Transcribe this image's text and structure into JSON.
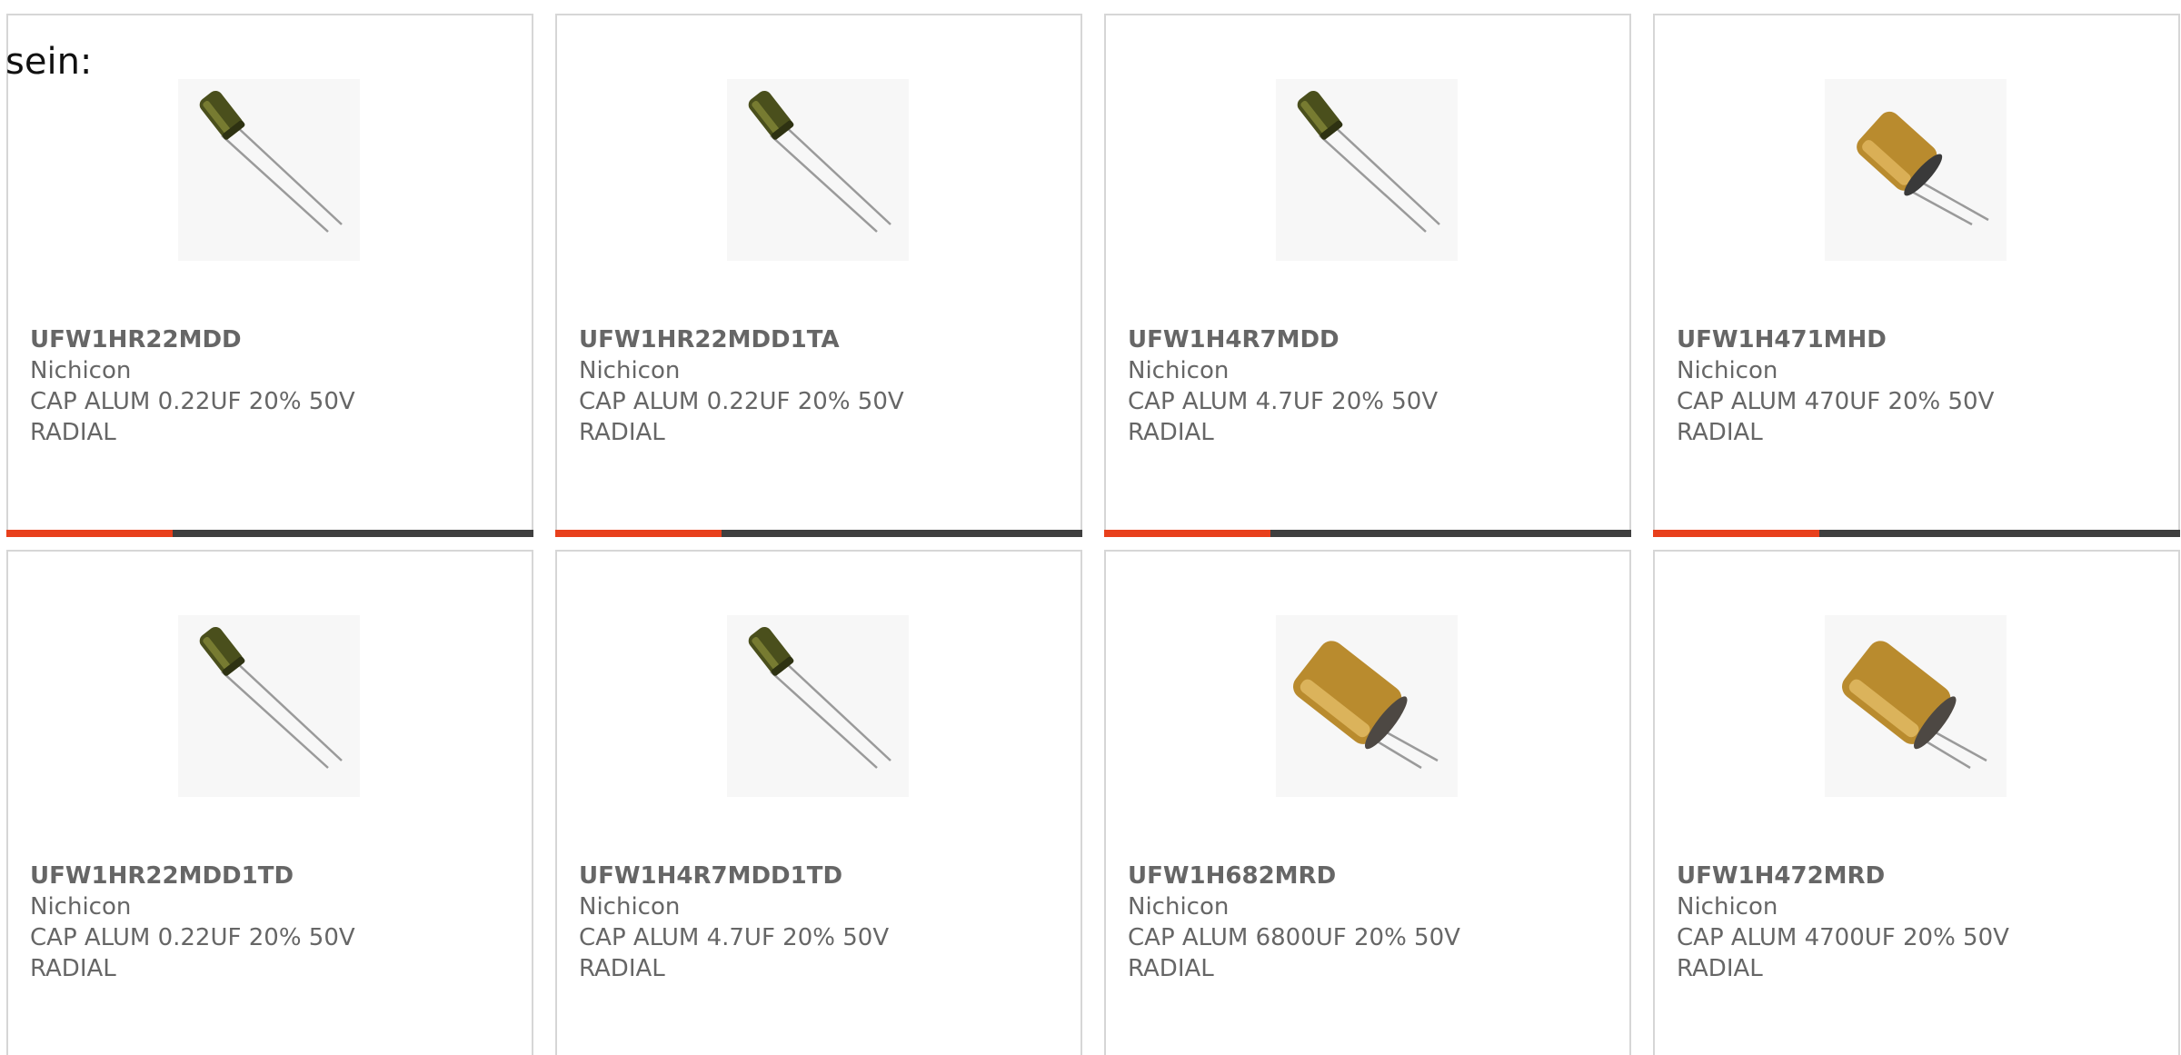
{
  "intro_text": "sein:",
  "colors": {
    "accent": "#e8401c",
    "bar": "#3f3f3f",
    "border": "#d6d6d6",
    "text": "#666666"
  },
  "products": [
    {
      "part": "UFW1HR22MDD",
      "manufacturer": "Nichicon",
      "description": "CAP ALUM 0.22UF 20% 50V RADIAL",
      "image": "small-green-capacitor"
    },
    {
      "part": "UFW1HR22MDD1TA",
      "manufacturer": "Nichicon",
      "description": "CAP ALUM 0.22UF 20% 50V RADIAL",
      "image": "small-green-capacitor"
    },
    {
      "part": "UFW1H4R7MDD",
      "manufacturer": "Nichicon",
      "description": "CAP ALUM 4.7UF 20% 50V RADIAL",
      "image": "small-green-capacitor"
    },
    {
      "part": "UFW1H471MHD",
      "manufacturer": "Nichicon",
      "description": "CAP ALUM 470UF 20% 50V RADIAL",
      "image": "gold-capacitor"
    },
    {
      "part": "UFW1HR22MDD1TD",
      "manufacturer": "Nichicon",
      "description": "CAP ALUM 0.22UF 20% 50V RADIAL",
      "image": "small-green-capacitor"
    },
    {
      "part": "UFW1H4R7MDD1TD",
      "manufacturer": "Nichicon",
      "description": "CAP ALUM 4.7UF 20% 50V RADIAL",
      "image": "small-green-capacitor"
    },
    {
      "part": "UFW1H682MRD",
      "manufacturer": "Nichicon",
      "description": "CAP ALUM 6800UF 20% 50V RADIAL",
      "image": "large-gold-capacitor"
    },
    {
      "part": "UFW1H472MRD",
      "manufacturer": "Nichicon",
      "description": "CAP ALUM 4700UF 20% 50V RADIAL",
      "image": "large-gold-capacitor"
    }
  ]
}
